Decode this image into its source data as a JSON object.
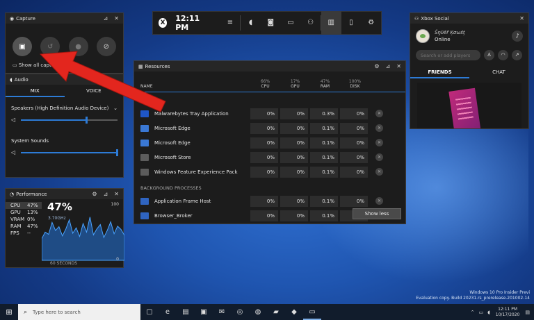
{
  "capture": {
    "title": "Capture",
    "show_all": "Show all captures"
  },
  "audio": {
    "title": "Audio",
    "tabs": [
      "MIX",
      "VOICE"
    ],
    "device": "Speakers (High Definition Audio Device)",
    "device_level": 0.68,
    "system_label": "System Sounds",
    "system_level": 1.0
  },
  "performance": {
    "title": "Performance",
    "items": [
      {
        "k": "CPU",
        "v": "47%"
      },
      {
        "k": "GPU",
        "v": "13%"
      },
      {
        "k": "VRAM",
        "v": "0%"
      },
      {
        "k": "RAM",
        "v": "47%"
      },
      {
        "k": "FPS",
        "v": "--"
      }
    ],
    "big": "47%",
    "sub": "3.70GHz",
    "max": "100",
    "min": "0",
    "window": "60 SECONDS",
    "series": [
      40,
      52,
      48,
      70,
      55,
      62,
      45,
      58,
      75,
      50,
      60,
      44,
      68,
      52,
      80,
      47,
      58,
      66,
      42,
      55,
      71,
      49,
      63,
      57,
      46
    ]
  },
  "topbar": {
    "clock": "12:11 PM"
  },
  "resources": {
    "title": "Resources",
    "col_name": "NAME",
    "cols": [
      {
        "p": "66%",
        "n": "CPU"
      },
      {
        "p": "17%",
        "n": "GPU"
      },
      {
        "p": "47%",
        "n": "RAM"
      },
      {
        "p": "100%",
        "n": "DISK"
      }
    ],
    "sec_apps": "APPS",
    "sec_bg": "BACKGROUND PROCESSES",
    "apps": [
      {
        "name": "Malwarebytes Tray Application",
        "cpu": "0%",
        "gpu": "0%",
        "ram": "0.3%",
        "disk": "0%",
        "color": "#1f56c7"
      },
      {
        "name": "Microsoft Edge",
        "cpu": "0%",
        "gpu": "0%",
        "ram": "0.1%",
        "disk": "0%",
        "color": "#3a78d4"
      },
      {
        "name": "Microsoft Edge",
        "cpu": "0%",
        "gpu": "0%",
        "ram": "0.1%",
        "disk": "0%",
        "color": "#3a78d4"
      },
      {
        "name": "Microsoft Store",
        "cpu": "0%",
        "gpu": "0%",
        "ram": "0.1%",
        "disk": "0%",
        "color": "#5c5c5c"
      },
      {
        "name": "Windows Feature Experience Pack",
        "cpu": "0%",
        "gpu": "0%",
        "ram": "0.1%",
        "disk": "0%",
        "color": "#5c5c5c"
      }
    ],
    "bg": [
      {
        "name": "Application Frame Host",
        "cpu": "0%",
        "gpu": "0%",
        "ram": "0.1%",
        "disk": "0%",
        "color": "#2f64c0"
      },
      {
        "name": "Browser_Broker",
        "cpu": "0%",
        "gpu": "0%",
        "ram": "0.1%",
        "disk": "0%",
        "color": "#2f64c0"
      }
    ],
    "show_less": "Show less"
  },
  "social": {
    "title": "Xbox Social",
    "gamertag": "Śŋϋĕř Ķσωśţ",
    "status": "Online",
    "search_placeholder": "Search or add players",
    "tabs": [
      "FRIENDS",
      "CHAT"
    ]
  },
  "watermark": {
    "line1": "Windows 10 Pro Insider Previ",
    "line2": "Evaluation copy. Build 20231.rs_prerelease.201002-14"
  },
  "taskbar": {
    "search_placeholder": "Type here to search",
    "time": "12:11 PM",
    "date": "10/17/2020"
  }
}
